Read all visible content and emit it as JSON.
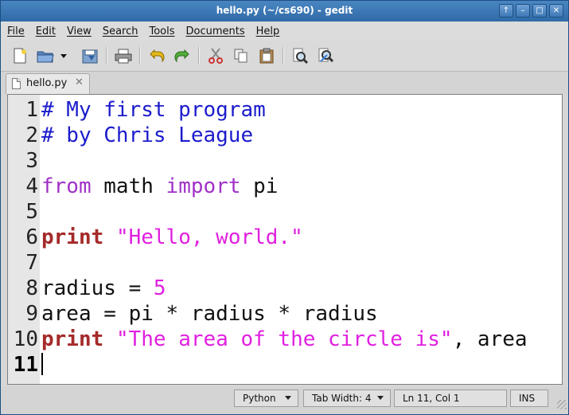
{
  "window": {
    "title": "hello.py (~/cs690) - gedit",
    "controls": [
      "↑",
      "–",
      "□",
      "✕"
    ]
  },
  "menu": [
    "File",
    "Edit",
    "View",
    "Search",
    "Tools",
    "Documents",
    "Help"
  ],
  "toolbar": {
    "icons": [
      "new-document-icon",
      "open-folder-icon",
      "dropdown-arrow-icon",
      "save-icon",
      "print-icon",
      "undo-icon",
      "redo-icon",
      "cut-icon",
      "copy-icon",
      "paste-icon",
      "find-icon",
      "find-replace-icon"
    ]
  },
  "tab": {
    "label": "hello.py",
    "close": "✕"
  },
  "editor": {
    "current_line": 11,
    "lines": [
      {
        "num": "1",
        "tokens": [
          {
            "t": "# My first program",
            "c": "comment"
          }
        ]
      },
      {
        "num": "2",
        "tokens": [
          {
            "t": "# by Chris League",
            "c": "comment"
          }
        ]
      },
      {
        "num": "3",
        "tokens": []
      },
      {
        "num": "4",
        "tokens": [
          {
            "t": "from",
            "c": "kw"
          },
          {
            "t": " math ",
            "c": ""
          },
          {
            "t": "import",
            "c": "kw"
          },
          {
            "t": " pi",
            "c": ""
          }
        ]
      },
      {
        "num": "5",
        "tokens": []
      },
      {
        "num": "6",
        "tokens": [
          {
            "t": "print",
            "c": "bold"
          },
          {
            "t": " ",
            "c": ""
          },
          {
            "t": "\"Hello, world.\"",
            "c": "str"
          }
        ]
      },
      {
        "num": "7",
        "tokens": []
      },
      {
        "num": "8",
        "tokens": [
          {
            "t": "radius = ",
            "c": ""
          },
          {
            "t": "5",
            "c": "num"
          }
        ]
      },
      {
        "num": "9",
        "tokens": [
          {
            "t": "area = pi * radius * radius",
            "c": ""
          }
        ]
      },
      {
        "num": "10",
        "tokens": [
          {
            "t": "print",
            "c": "bold"
          },
          {
            "t": " ",
            "c": ""
          },
          {
            "t": "\"The area of the circle is\"",
            "c": "str"
          },
          {
            "t": ", area",
            "c": ""
          }
        ]
      },
      {
        "num": "11",
        "tokens": []
      }
    ]
  },
  "status": {
    "language": "Python",
    "tab_width": "Tab Width:  4",
    "position": "Ln 11, Col 1",
    "mode": "INS"
  }
}
